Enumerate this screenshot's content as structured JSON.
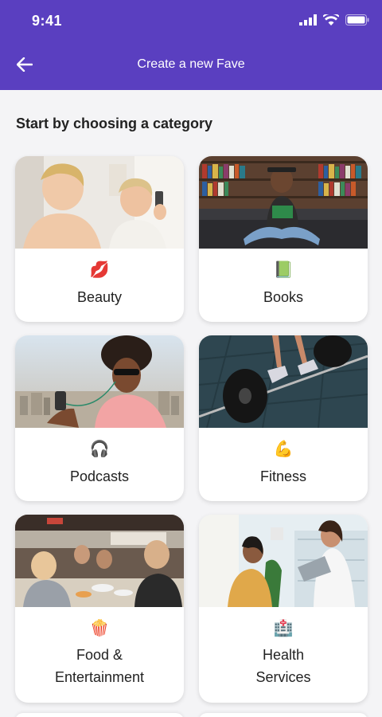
{
  "status_bar": {
    "time": "9:41"
  },
  "header": {
    "title": "Create a new Fave",
    "back_icon": "arrow-left-icon",
    "background": "#5a3fc0"
  },
  "section": {
    "title": "Start by choosing a category"
  },
  "categories": [
    {
      "label": "Beauty",
      "emoji": "💋"
    },
    {
      "label": "Books",
      "emoji": "📗"
    },
    {
      "label": "Podcasts",
      "emoji": "🎧"
    },
    {
      "label": "Fitness",
      "emoji": "💪"
    },
    {
      "label_line1": "Food &",
      "label_line2": "Entertainment",
      "emoji": "🍿"
    },
    {
      "label_line1": "Health",
      "label_line2": "Services",
      "emoji": "🏥"
    }
  ]
}
